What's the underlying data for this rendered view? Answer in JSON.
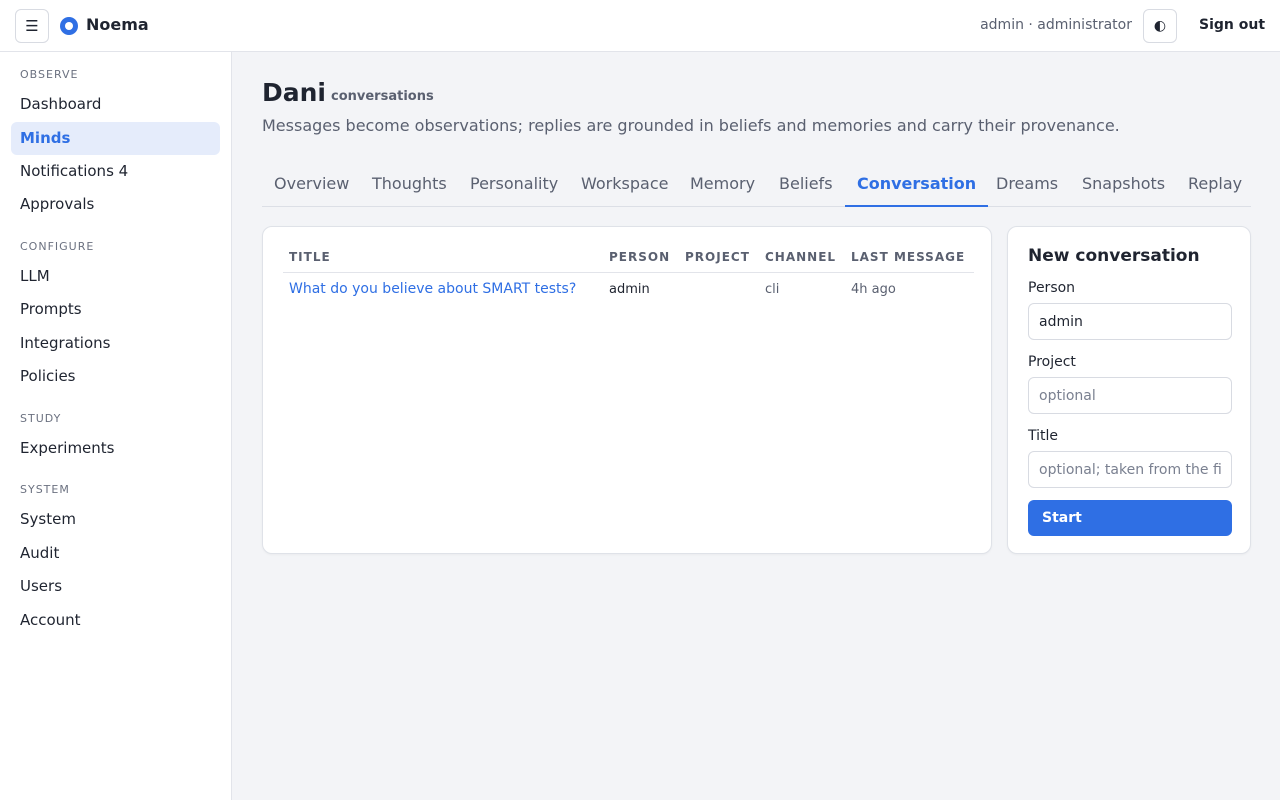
{
  "header": {
    "menu_icon": "☰",
    "brand": "Noema",
    "user": "admin · administrator",
    "theme_icon": "◐",
    "signout": "Sign out"
  },
  "sidebar": {
    "sections": [
      {
        "label": "OBSERVE",
        "items": [
          "Dashboard",
          "Minds",
          "Notifications 4",
          "Approvals"
        ]
      },
      {
        "label": "CONFIGURE",
        "items": [
          "LLM",
          "Prompts",
          "Integrations",
          "Policies"
        ]
      },
      {
        "label": "STUDY",
        "items": [
          "Experiments"
        ]
      },
      {
        "label": "SYSTEM",
        "items": [
          "System",
          "Audit",
          "Users",
          "Account"
        ]
      }
    ],
    "active": "Minds"
  },
  "page": {
    "title": "Dani",
    "subtitle": "conversations",
    "description": "Messages become observations; replies are grounded in beliefs and memories and carry their provenance."
  },
  "tabs": [
    "Overview",
    "Thoughts",
    "Personality",
    "Workspace",
    "Memory",
    "Beliefs",
    "Conversation",
    "Dreams",
    "Snapshots",
    "Replay"
  ],
  "active_tab": "Conversation",
  "table": {
    "headers": [
      "TITLE",
      "PERSON",
      "PROJECT",
      "CHANNEL",
      "LAST MESSAGE"
    ],
    "rows": [
      {
        "title": "What do you believe about SMART tests?",
        "person": "admin",
        "project": "",
        "channel": "cli",
        "last_message": "4h ago"
      }
    ]
  },
  "new_conversation": {
    "heading": "New conversation",
    "person_label": "Person",
    "person_value": "admin",
    "project_label": "Project",
    "project_placeholder": "optional",
    "title_label": "Title",
    "title_placeholder": "optional; taken from the first message",
    "start_label": "Start"
  },
  "colors": {
    "accent": "#2f6fe4",
    "background": "#f3f4f7",
    "active_nav_bg": "#e5ecfb"
  }
}
